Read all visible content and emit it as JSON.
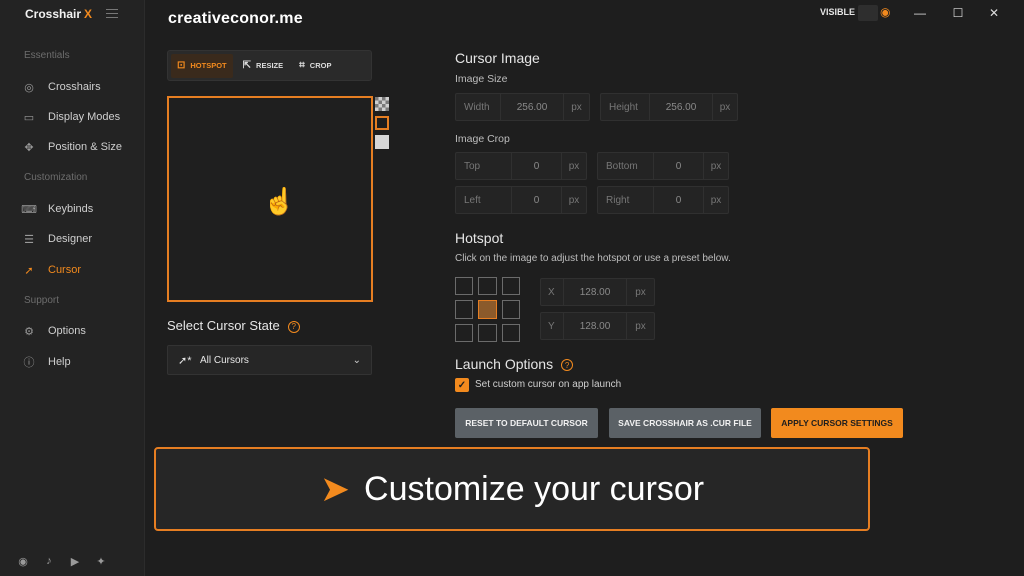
{
  "app": {
    "name": "Crosshair",
    "name_x": "X"
  },
  "watermark": "creativeconor.me",
  "topbar": {
    "visible_label": "VISIBLE"
  },
  "sidebar": {
    "sections": [
      "Essentials",
      "Customization",
      "Support"
    ],
    "items": [
      {
        "label": "Crosshairs",
        "icon": "crosshair-icon"
      },
      {
        "label": "Display Modes",
        "icon": "display-icon"
      },
      {
        "label": "Position & Size",
        "icon": "move-icon"
      },
      {
        "label": "Keybinds",
        "icon": "keyboard-icon"
      },
      {
        "label": "Designer",
        "icon": "sliders-icon"
      },
      {
        "label": "Cursor",
        "icon": "cursor-icon",
        "active": true
      },
      {
        "label": "Options",
        "icon": "gear-icon"
      },
      {
        "label": "Help",
        "icon": "help-icon"
      }
    ],
    "social": [
      "discord-icon",
      "tiktok-icon",
      "youtube-icon",
      "twitter-icon"
    ]
  },
  "tools": {
    "hotspot": "HOTSPOT",
    "resize": "RESIZE",
    "crop": "CROP"
  },
  "cursor_state": {
    "title": "Select Cursor State",
    "selected": "All Cursors"
  },
  "cursor_image": {
    "title": "Cursor Image",
    "size_label": "Image Size",
    "width": {
      "label": "Width",
      "value": "256.00",
      "unit": "px"
    },
    "height": {
      "label": "Height",
      "value": "256.00",
      "unit": "px"
    },
    "crop_label": "Image Crop",
    "top": {
      "label": "Top",
      "value": "0",
      "unit": "px"
    },
    "bottom": {
      "label": "Bottom",
      "value": "0",
      "unit": "px"
    },
    "left": {
      "label": "Left",
      "value": "0",
      "unit": "px"
    },
    "right": {
      "label": "Right",
      "value": "0",
      "unit": "px"
    }
  },
  "hotspot": {
    "title": "Hotspot",
    "description": "Click on the image to adjust the hotspot or use a preset below.",
    "x": {
      "label": "X",
      "value": "128.00",
      "unit": "px"
    },
    "y": {
      "label": "Y",
      "value": "128.00",
      "unit": "px"
    }
  },
  "launch": {
    "title": "Launch Options",
    "checkbox_label": "Set custom cursor on app launch",
    "checked": true
  },
  "buttons": {
    "reset": "RESET TO DEFAULT CURSOR",
    "save": "SAVE CROSSHAIR AS .CUR FILE",
    "apply": "APPLY CURSOR SETTINGS"
  },
  "banner": {
    "text": "Customize your cursor"
  },
  "colors": {
    "accent": "#f28a1e",
    "background": "#1e1e1e"
  }
}
